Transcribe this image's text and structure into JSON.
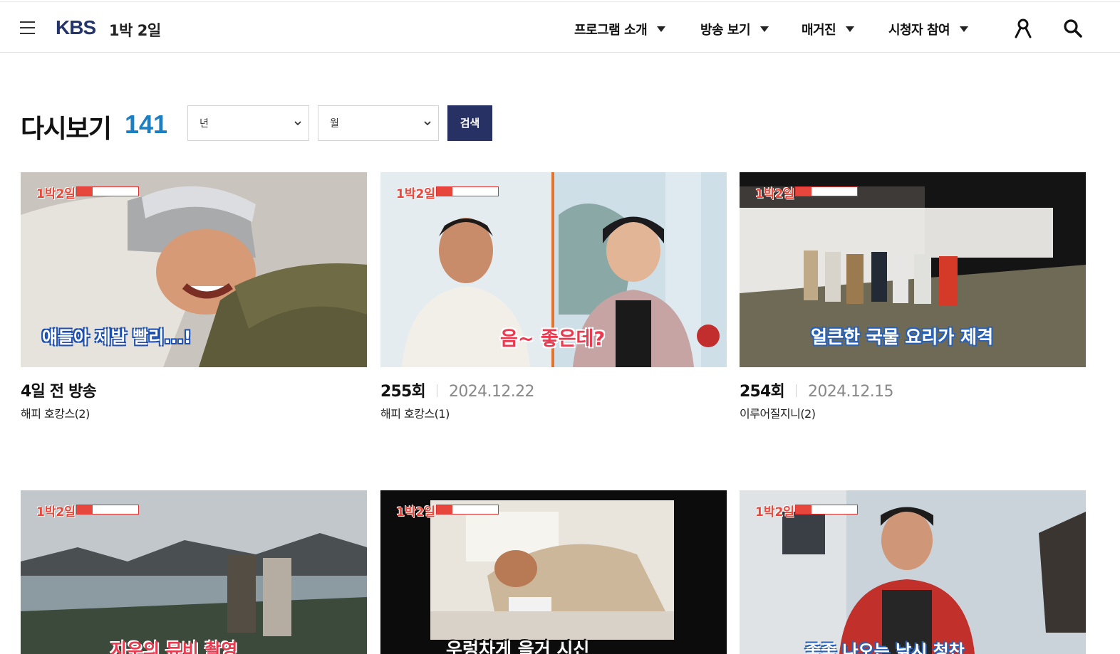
{
  "header": {
    "brand": "KBS",
    "program": "1박 2일",
    "nav": [
      {
        "label": "프로그램 소개"
      },
      {
        "label": "방송 보기"
      },
      {
        "label": "매거진"
      },
      {
        "label": "시청자 참여"
      }
    ],
    "icons": [
      "menu-icon",
      "user-icon",
      "search-icon"
    ]
  },
  "filters": {
    "title": "다시보기",
    "count": "141",
    "year_select": "년",
    "month_select": "월",
    "search_label": "검색"
  },
  "episodes": [
    {
      "episode": "4일 전 방송",
      "date": "",
      "subtitle": "해피 호캉스(2)",
      "caption": "얘들아 제발 빨리...!"
    },
    {
      "episode": "255회",
      "date": "2024.12.22",
      "subtitle": "해피 호캉스(1)",
      "caption": "음~ 좋은데?"
    },
    {
      "episode": "254회",
      "date": "2024.12.15",
      "subtitle": "이루어질지니(2)",
      "caption": "얼큰한 국물 요리가 제격"
    },
    {
      "episode": "",
      "date": "",
      "subtitle": "",
      "caption": "지우의 뮤비 촬영"
    },
    {
      "episode": "",
      "date": "",
      "subtitle": "",
      "caption": "우렁차게 을거 시신"
    },
    {
      "episode": "",
      "date": "",
      "subtitle": "",
      "caption": "좋좋 나오는 낚시 청찬"
    }
  ],
  "thumb_logo": "1박2일",
  "colors": {
    "accent": "#1b7fc4",
    "button": "#283163",
    "brand": "#23356b"
  }
}
